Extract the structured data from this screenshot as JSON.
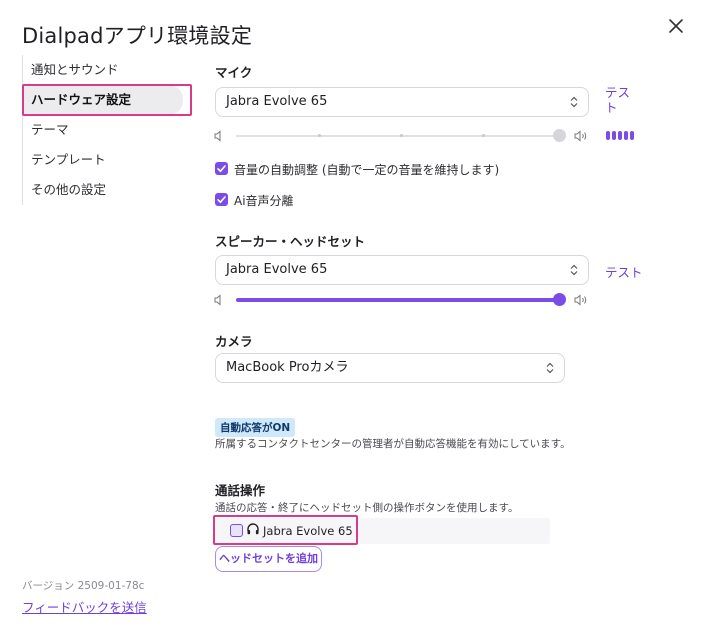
{
  "window": {
    "title": "Dialpadアプリ環境設定"
  },
  "sidebar": {
    "items": [
      {
        "label": "通知とサウンド"
      },
      {
        "label": "ハードウェア設定"
      },
      {
        "label": "テーマ"
      },
      {
        "label": "テンプレート"
      },
      {
        "label": "その他の設定"
      }
    ],
    "active_index": 1,
    "version": "バージョン 2509-01-78c",
    "feedback_link": "フィードバックを送信"
  },
  "mic": {
    "label": "マイク",
    "device": "Jabra Evolve 65",
    "test_link": "テスト",
    "volume_level": 1.0,
    "auto_gain_label": "音量の自動調整 (自動で一定の音量を維持します)",
    "auto_gain_checked": true,
    "noise_separation_label": "Ai音声分離",
    "noise_separation_checked": true
  },
  "speaker": {
    "label": "スピーカー・ヘッドセット",
    "device": "Jabra Evolve 65",
    "test_link": "テスト",
    "volume_level": 1.0
  },
  "camera": {
    "label": "カメラ",
    "device": "MacBook Proカメラ"
  },
  "auto_answer": {
    "badge": "自動応答がON",
    "description": "所属するコンタクトセンターの管理者が自動応答機能を有効にしています。"
  },
  "call_control": {
    "label": "通話操作",
    "description": "通話の応答・終了にヘッドセット側の操作ボタンを使用します。",
    "device_name": "Jabra Evolve 65",
    "device_checked": false,
    "add_button": "ヘッドセットを追加"
  },
  "colors": {
    "accent": "#7c4ce6",
    "highlight": "#d63c8a",
    "link": "#6f3fe0"
  }
}
